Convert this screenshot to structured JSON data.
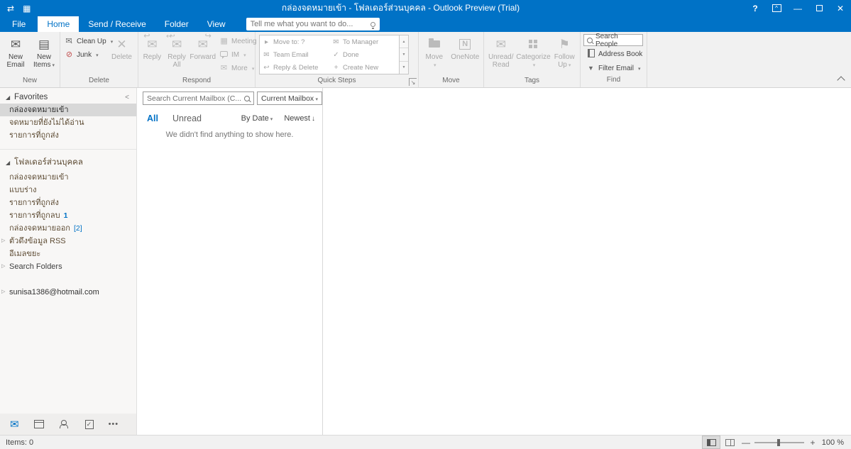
{
  "colors": {
    "titlebar_blue": "#0072C6",
    "accent": "#0072C6",
    "count_blue": "#0072C6"
  },
  "titlebar": {
    "title": "กล่องจดหมายเข้า - โฟลเดอร์ส่วนบุคคล - Outlook Preview (Trial)"
  },
  "tabs": {
    "file": "File",
    "home": "Home",
    "send_receive": "Send / Receive",
    "folder": "Folder",
    "view": "View",
    "tellme_placeholder": "Tell me what you want to do..."
  },
  "ribbon": {
    "new": {
      "label": "New",
      "new_email_1": "New",
      "new_email_2": "Email",
      "new_items_1": "New",
      "new_items_2": "Items"
    },
    "delete": {
      "label": "Delete",
      "clean_up": "Clean Up",
      "junk": "Junk",
      "delete_btn": "Delete"
    },
    "respond": {
      "label": "Respond",
      "reply": "Reply",
      "reply_all_1": "Reply",
      "reply_all_2": "All",
      "forward": "Forward",
      "meeting": "Meeting",
      "im": "IM",
      "more": "More"
    },
    "quick_steps": {
      "label": "Quick Steps",
      "col1": [
        "Move to: ?",
        "Team Email",
        "Reply & Delete"
      ],
      "col2": [
        "To Manager",
        "Done",
        "Create New"
      ]
    },
    "move": {
      "label": "Move",
      "move": "Move",
      "onenote": "OneNote"
    },
    "tags": {
      "label": "Tags",
      "unread_1": "Unread/",
      "unread_2": "Read",
      "categorize": "Categorize",
      "follow_1": "Follow",
      "follow_2": "Up"
    },
    "find": {
      "label": "Find",
      "search_people": "Search People",
      "address_book": "Address Book",
      "filter_email": "Filter Email"
    }
  },
  "sidebar": {
    "favorites_header": "Favorites",
    "fav_items": [
      {
        "label": "กล่องจดหมายเข้า"
      },
      {
        "label": "จดหมายที่ยังไม่ได้อ่าน"
      },
      {
        "label": "รายการที่ถูกส่ง"
      }
    ],
    "account_header": "โฟลเดอร์ส่วนบุคคล",
    "account_items": [
      {
        "label": "กล่องจดหมายเข้า"
      },
      {
        "label": "แบบร่าง"
      },
      {
        "label": "รายการที่ถูกส่ง"
      },
      {
        "label": "รายการที่ถูกลบ",
        "count": "1"
      },
      {
        "label": "กล่องจดหมายออก",
        "count": "[2]"
      },
      {
        "label": "ตัวดึงข้อมูล RSS"
      },
      {
        "label": "อีเมลขยะ"
      },
      {
        "label": "Search Folders"
      }
    ],
    "account2": "sunisa1386@hotmail.com"
  },
  "list": {
    "search_placeholder": "Search Current Mailbox (C...",
    "scope": "Current Mailbox",
    "filter_all": "All",
    "filter_unread": "Unread",
    "sort_by": "By Date",
    "sort_dir": "Newest",
    "empty": "We didn't find anything to show here."
  },
  "statusbar": {
    "items": "Items: 0",
    "zoom": "100 %"
  }
}
